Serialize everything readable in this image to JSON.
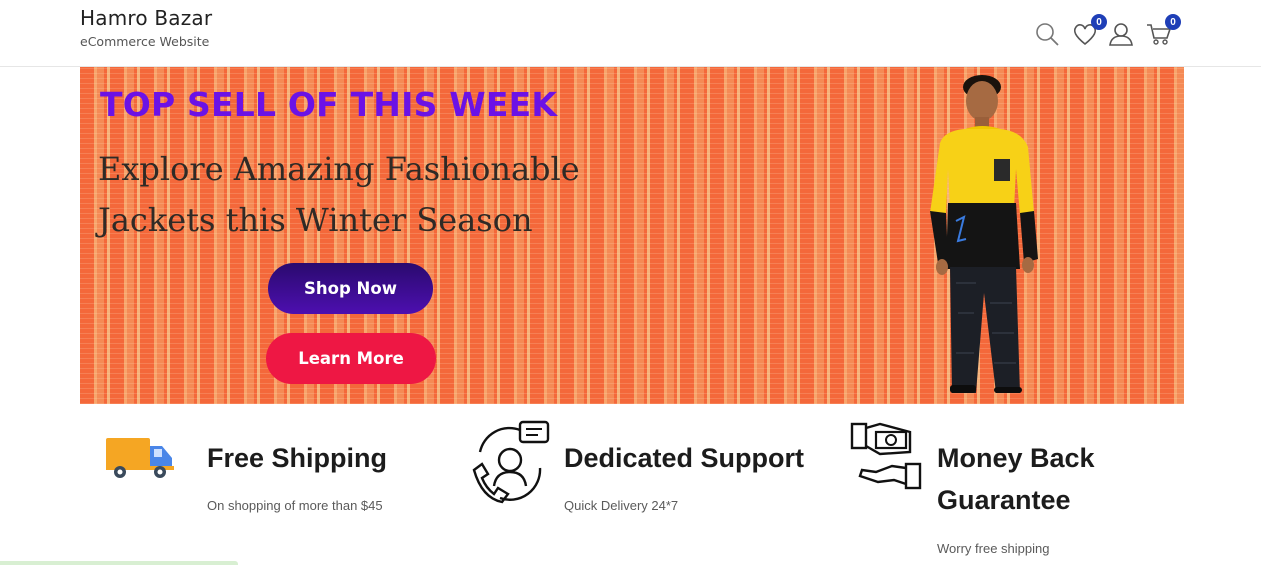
{
  "brand": {
    "title": "Hamro Bazar",
    "subtitle": "eCommerce Website"
  },
  "header_icons": [
    {
      "name": "search-icon"
    },
    {
      "name": "heart-icon",
      "badge": "0"
    },
    {
      "name": "user-icon"
    },
    {
      "name": "cart-icon",
      "badge": "0"
    }
  ],
  "banner": {
    "kicker": "TOP SELL OF THIS WEEK",
    "headline_line1": "Explore Amazing Fashionable",
    "headline_line2": "Jackets this Winter Season",
    "shop_now": "Shop Now",
    "learn_more": "Learn More"
  },
  "features": [
    {
      "icon": "delivery-truck-icon",
      "title": "Free Shipping",
      "desc": "On shopping of more than $45"
    },
    {
      "icon": "support-agent-icon",
      "title": "Dedicated Support",
      "desc": "Quick Delivery 24*7"
    },
    {
      "icon": "money-back-icon",
      "title_line1": "Money Back",
      "title_line2": "Guarantee",
      "desc": "Worry free shipping"
    }
  ],
  "colors": {
    "accent_purple": "#6b12e6",
    "learn_more": "#ee1744",
    "badge": "#1f3fb7",
    "banner_bg": "#f77748"
  }
}
